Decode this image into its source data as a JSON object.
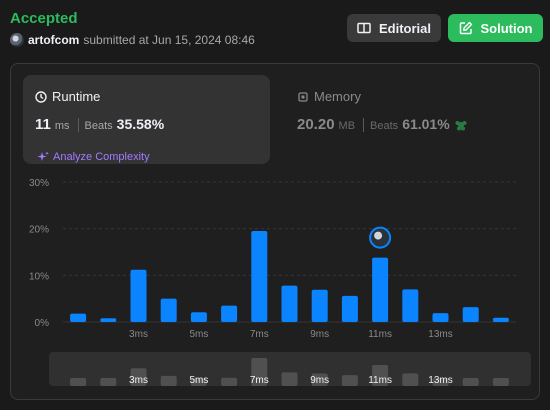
{
  "header": {
    "status": "Accepted",
    "username": "artofcom",
    "submitted_text": "submitted at Jun 15, 2024 08:46",
    "editorial_label": "Editorial",
    "solution_label": "Solution"
  },
  "runtime": {
    "label": "Runtime",
    "value": "11",
    "unit": "ms",
    "beats_label": "Beats",
    "beats_pct": "35.58%",
    "analyze_label": "Analyze Complexity"
  },
  "memory": {
    "label": "Memory",
    "value": "20.20",
    "unit": "MB",
    "beats_label": "Beats",
    "beats_pct": "61.01%"
  },
  "colors": {
    "accent_green": "#2cbb5d",
    "bar_blue": "#0a84ff",
    "analyze_purple": "#a37bff"
  },
  "chart_data": {
    "type": "bar",
    "y_tick_labels": [
      "0%",
      "10%",
      "20%",
      "30%"
    ],
    "ylim": [
      0,
      30
    ],
    "x_tick_labels": [
      "3ms",
      "5ms",
      "7ms",
      "9ms",
      "11ms",
      "13ms"
    ],
    "x_tick_bar_index": [
      2,
      4,
      6,
      8,
      10,
      12
    ],
    "x_values_ms": [
      1,
      2,
      3,
      4,
      5,
      6,
      7,
      8,
      9,
      10,
      11,
      12,
      13,
      14,
      15
    ],
    "values": [
      1.8,
      0.8,
      11.2,
      5.0,
      2.1,
      3.5,
      19.5,
      7.8,
      6.9,
      5.6,
      13.8,
      7.0,
      1.9,
      3.2,
      0.9
    ],
    "highlight_bar_index": 10,
    "grid": true
  }
}
